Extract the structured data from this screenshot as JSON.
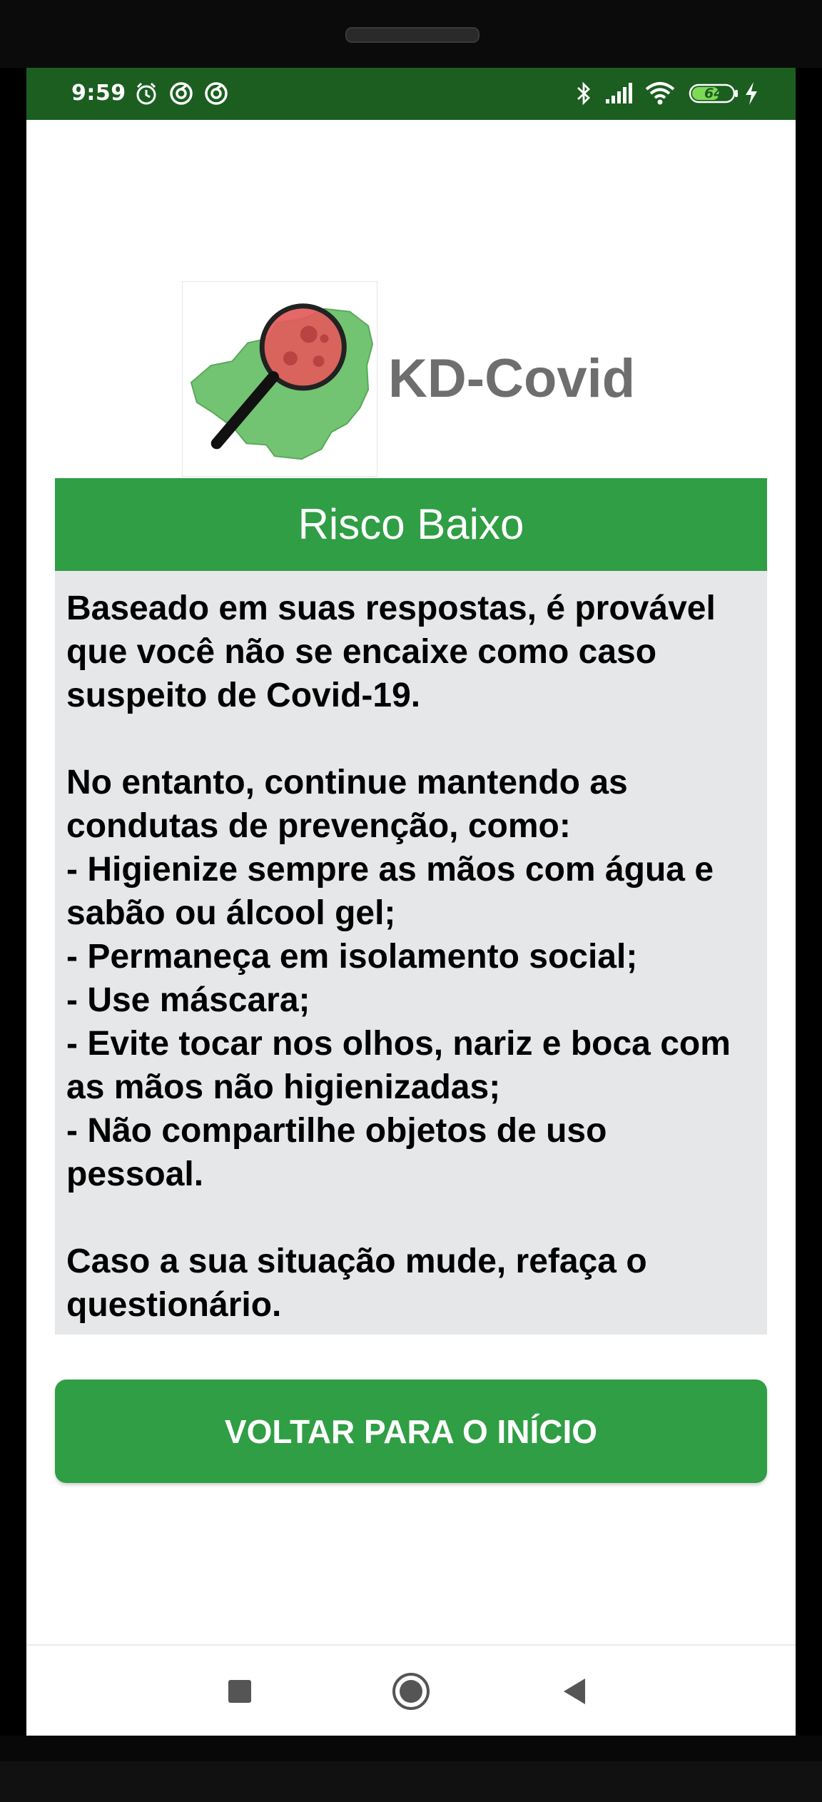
{
  "status_bar": {
    "time": "9:59",
    "battery_level": "64",
    "icons": [
      "alarm-icon",
      "sync-icon",
      "sync-icon",
      "bluetooth-icon",
      "signal-icon",
      "wifi-icon",
      "battery-icon",
      "charging-icon"
    ]
  },
  "header": {
    "app_title": "KD-Covid",
    "logo_icon": "minas-gerais-magnifier-logo"
  },
  "result": {
    "risk_title": "Risco Baixo",
    "intro_lines": [
      "Baseado em suas respostas, é provável",
      "que você não se encaixe como caso",
      "suspeito de Covid-19."
    ],
    "advice_lines": [
      "No entanto, continue mantendo as",
      "condutas de prevenção, como:",
      "- Higienize sempre as mãos com água e",
      "sabão ou álcool gel;",
      "- Permaneça em isolamento social;",
      "- Use máscara;",
      "- Evite tocar nos olhos, nariz e boca com",
      "as mãos não higienizadas;",
      "- Não compartilhe objetos de uso",
      "pessoal."
    ],
    "closing_lines": [
      "Caso a sua situação mude, refaça o",
      "questionário."
    ]
  },
  "actions": {
    "back_button_label": "VOLTAR PARA O INÍCIO"
  },
  "colors": {
    "status_bar": "#1b5e20",
    "accent_green": "#2f9e44",
    "message_bg": "#e6e7e9",
    "title_gray": "#6e6e6e"
  },
  "nav_bar": {
    "buttons": [
      "recents-square-icon",
      "home-circle-icon",
      "back-triangle-icon"
    ]
  }
}
